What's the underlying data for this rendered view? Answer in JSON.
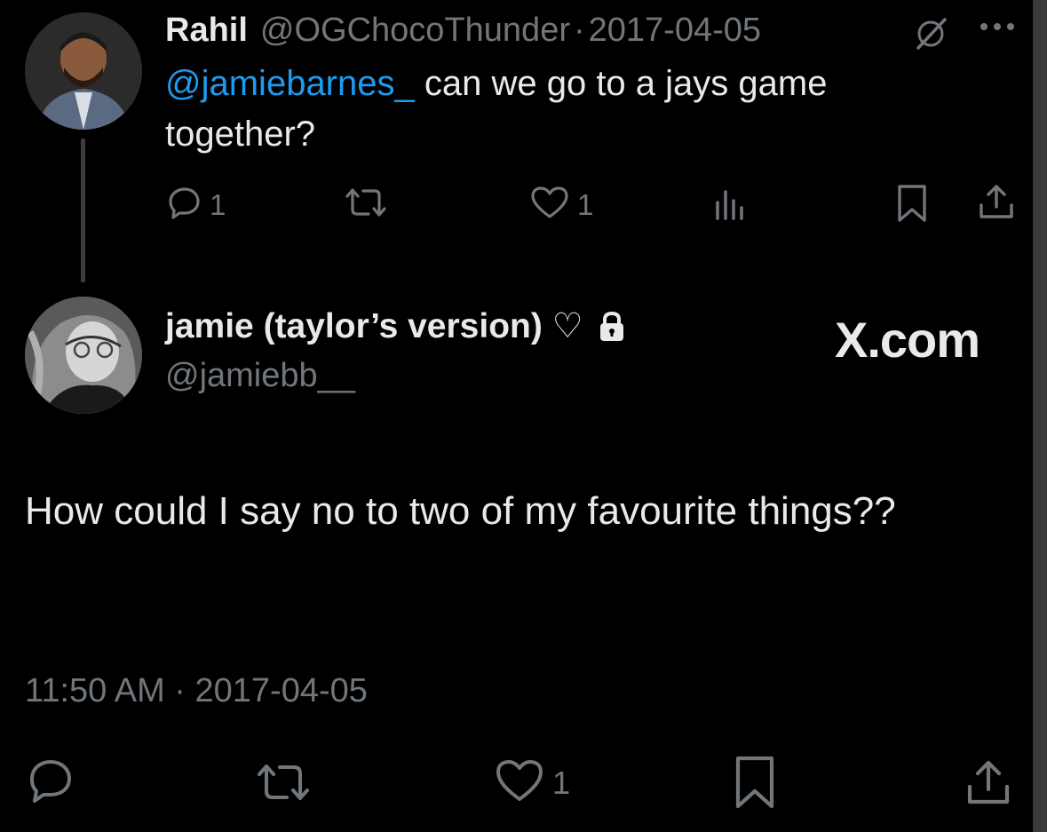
{
  "tweet1": {
    "display_name": "Rahil",
    "handle": "@OGChocoThunder",
    "separator": "·",
    "date": "2017-04-05",
    "mention": "@jamiebarnes_",
    "text": " can we go to a jays game together?",
    "reply_count": "1",
    "like_count": "1"
  },
  "tweet2": {
    "display_name": "jamie (taylor’s version) ♡",
    "handle": "@jamiebb__",
    "brand": "X.com",
    "text": "How could I say no to two of my favourite things??",
    "timestamp": "11:50 AM · 2017-04-05",
    "like_count": "1"
  },
  "colors": {
    "background": "#000000",
    "text": "#e7e9ea",
    "muted": "#71767b",
    "link": "#1d9bf0"
  },
  "icons": [
    "grok-icon",
    "more-icon",
    "reply-icon",
    "retweet-icon",
    "like-icon",
    "views-icon",
    "bookmark-icon",
    "share-icon",
    "lock-icon"
  ]
}
